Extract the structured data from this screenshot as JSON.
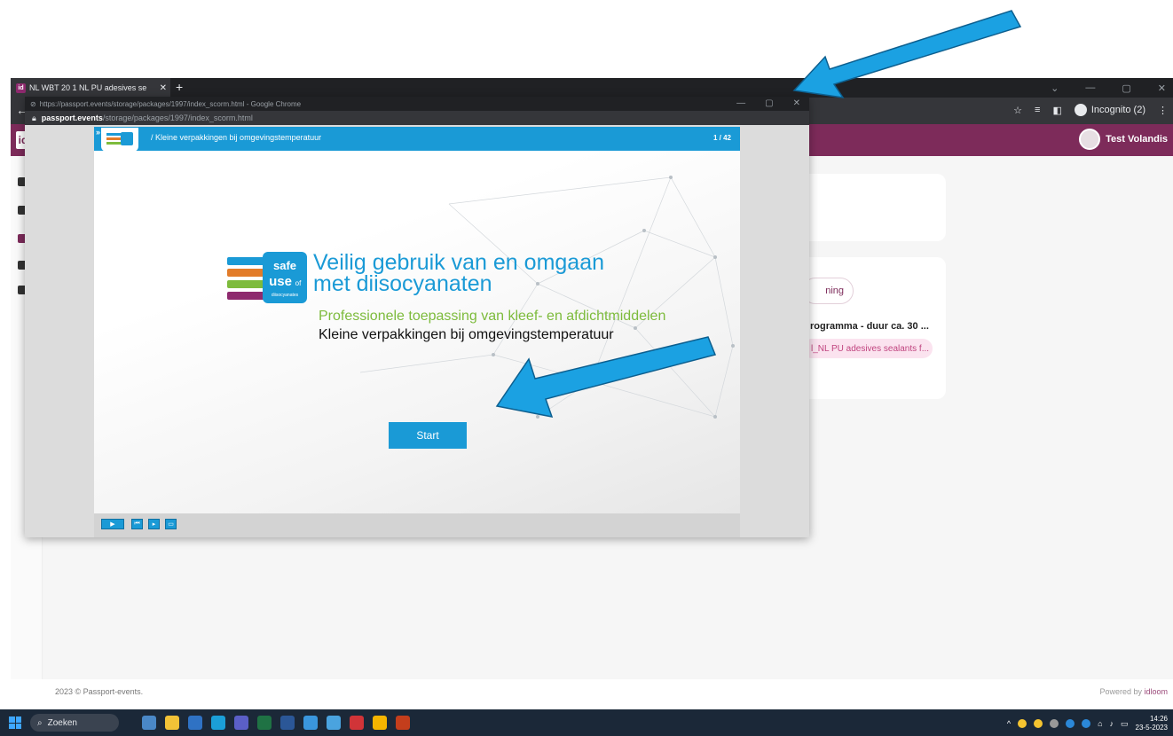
{
  "browser": {
    "tab_title": "NL WBT 20 1 NL PU adesives se",
    "tab_icon_text": "id",
    "incognito_label": "Incognito (2)"
  },
  "app": {
    "logo_text": "id",
    "user_name": "Test Volandis",
    "card": {
      "pill_label": "ning",
      "program_title": "rogramma - duur ca. 30 ...",
      "course_tag": "l_NL PU adesives sealants f..."
    },
    "footer_left": "2023 © Passport-events.",
    "footer_powered": "Powered by ",
    "footer_brand": "idloom"
  },
  "popup": {
    "title": "https://passport.events/storage/packages/1997/index_scorm.html - Google Chrome",
    "url_host": "passport.events",
    "url_path": "/storage/packages/1997/index_scorm.html"
  },
  "scorm": {
    "slide_title": "/ Kleine verpakkingen bij omgevingstemperatuur",
    "slide_counter": "1 / 42",
    "logo_line1": "safe",
    "logo_line2": "use",
    "logo_of": "of",
    "logo_line3": "diisocyanates",
    "main_title_line1": "Veilig gebruik van en omgaan",
    "main_title_line2": "met diisocyanaten",
    "subtitle_green": "Professionele toepassing van kleef- en afdichtmiddelen",
    "subtitle_black": "Kleine verpakkingen bij omgevingstemperatuur",
    "start_label": "Start"
  },
  "taskbar": {
    "search_label": "Zoeken",
    "time": "14:26",
    "date": "23-5-2023"
  },
  "colors": {
    "accent_blue": "#1a9ad6",
    "app_purple": "#7d2b5a",
    "arrow_blue": "#1ba1e2"
  }
}
